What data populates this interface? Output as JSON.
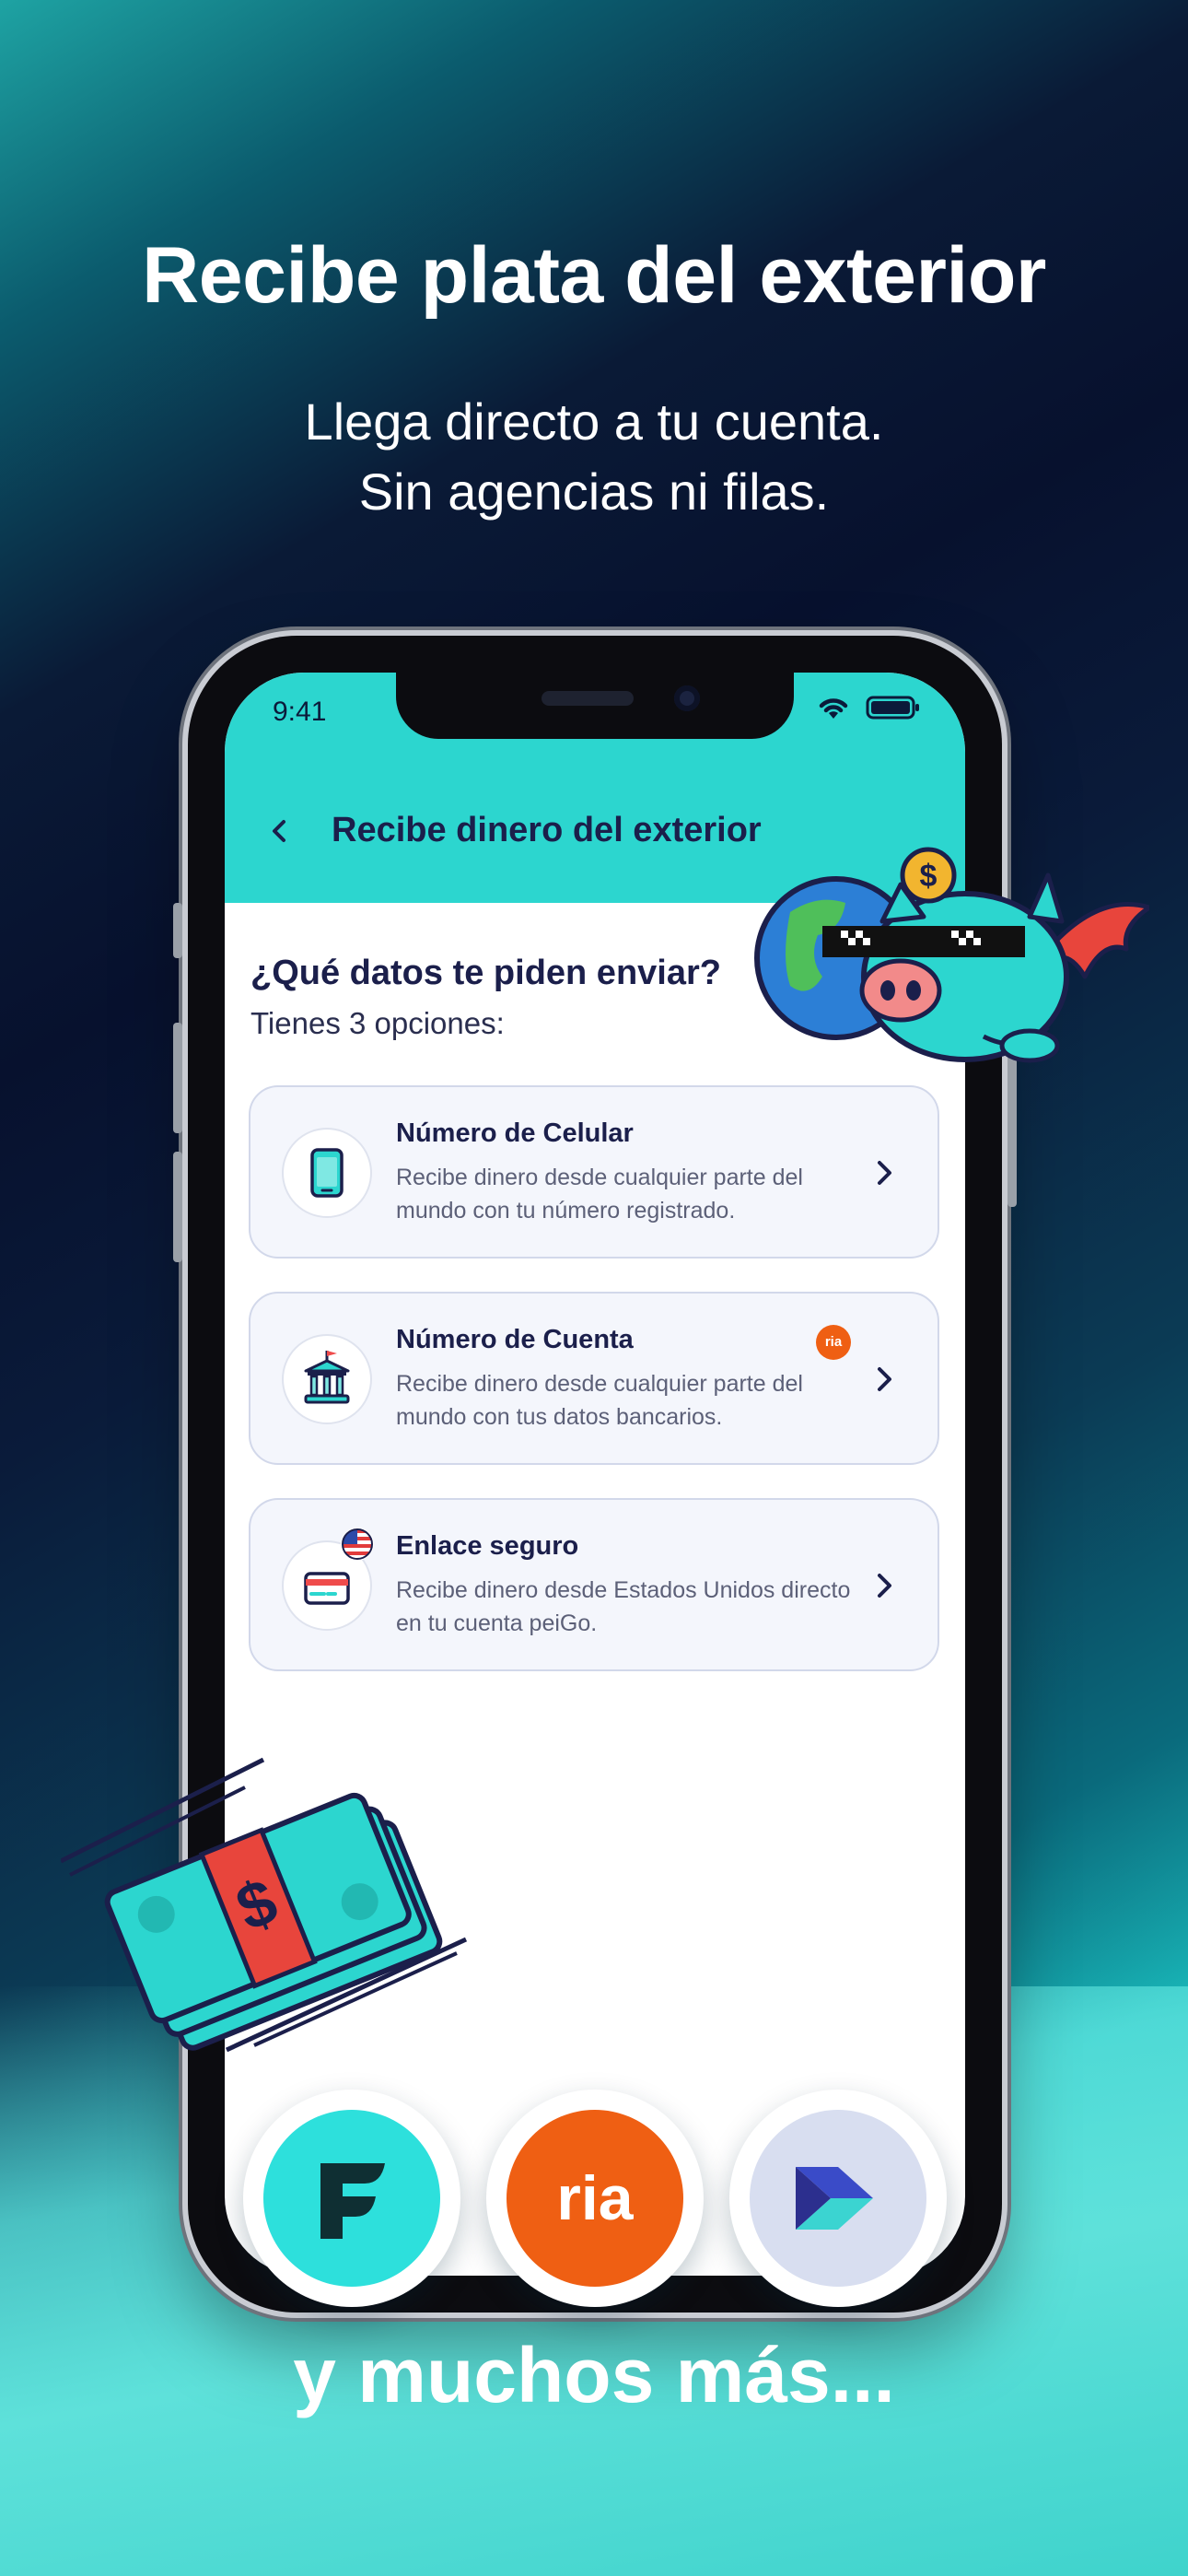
{
  "hero": {
    "headline": "Recibe plata del exterior",
    "subline_1": "Llega directo a tu cuenta.",
    "subline_2": "Sin agencias ni filas."
  },
  "status_bar": {
    "time": "9:41"
  },
  "app": {
    "nav_title": "Recibe dinero del exterior",
    "question": "¿Qué datos te piden enviar?",
    "options_count": "Tienes 3 opciones:",
    "options": [
      {
        "title": "Número de Celular",
        "description": "Recibe dinero desde cualquier parte del mundo con tu número registrado.",
        "icon": "smartphone-icon"
      },
      {
        "title": "Número de Cuenta",
        "description": "Recibe dinero desde cualquier parte del mundo con tus datos bancarios.",
        "icon": "bank-icon",
        "badge": "ria"
      },
      {
        "title": "Enlace seguro",
        "description": "Recibe dinero desde Estados Unidos directo en tu cuenta peiGo.",
        "icon": "card-icon",
        "flag": "us-flag-icon"
      }
    ]
  },
  "partners": [
    {
      "name": "F",
      "color": "#2de0dc"
    },
    {
      "name": "ria",
      "color": "#ef5f13"
    },
    {
      "name": "arrow-logo",
      "color": "#d8def0"
    }
  ],
  "footer": {
    "text": "y muchos más..."
  },
  "colors": {
    "header": "#2cd6cf",
    "title": "#1b1f4b",
    "accent": "#ef5f13"
  }
}
